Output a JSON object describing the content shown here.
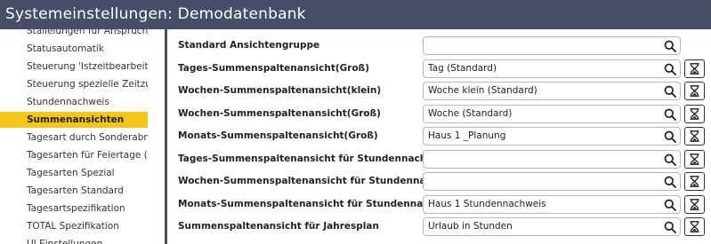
{
  "window": {
    "title": "Systemeinstellungen: Demodatenbank"
  },
  "sidebar": {
    "items": [
      {
        "label": "Stallelungen für Anspruch",
        "active": false
      },
      {
        "label": "Statusautomatik",
        "active": false
      },
      {
        "label": "Steuerung 'Istzeitbearbeitun",
        "active": false
      },
      {
        "label": "Steuerung spezielle Zeitzusc",
        "active": false
      },
      {
        "label": "Stundennachweis",
        "active": false
      },
      {
        "label": "Summenansichten",
        "active": true
      },
      {
        "label": "Tagesart durch Sonderabrecl",
        "active": false
      },
      {
        "label": "Tagesarten für Feiertage (für",
        "active": false
      },
      {
        "label": "Tagesarten Spezial",
        "active": false
      },
      {
        "label": "Tagesarten Standard",
        "active": false
      },
      {
        "label": "Tagesartspezifikation",
        "active": false
      },
      {
        "label": "TOTAL Spezifikation",
        "active": false
      },
      {
        "label": "UI Einstellungen",
        "active": false
      }
    ]
  },
  "settings": {
    "rows": [
      {
        "label": "Standard Ansichtengruppe",
        "value": "",
        "has_reset": false
      },
      {
        "label": "Tages-Summenspaltenansicht(Groß)",
        "value": "Tag (Standard)",
        "has_reset": true
      },
      {
        "label": "Wochen-Summenspaltenansicht(klein)",
        "value": "Woche klein (Standard)",
        "has_reset": true
      },
      {
        "label": "Wochen-Summenspaltenansicht(Groß)",
        "value": "Woche (Standard)",
        "has_reset": true
      },
      {
        "label": "Monats-Summenspaltenansicht(Groß)",
        "value": "Haus 1 _Planung",
        "has_reset": true
      },
      {
        "label": "Tages-Summenspaltenansicht für Stundennachweis",
        "value": "",
        "has_reset": true
      },
      {
        "label": "Wochen-Summenspaltenansicht für Stundennachweis",
        "value": "",
        "has_reset": true
      },
      {
        "label": "Monats-Summenspaltenansicht für Stundennachweis",
        "value": "Haus 1 Stundennachweis",
        "has_reset": true
      },
      {
        "label": "Summenspaltenansicht für Jahresplan",
        "value": "Urlaub in Stunden",
        "has_reset": true
      }
    ]
  },
  "icons": {
    "search": "search-icon",
    "reset": "hourglass-icon"
  },
  "colors": {
    "titlebar": "#464e68",
    "active": "#f5c518"
  }
}
